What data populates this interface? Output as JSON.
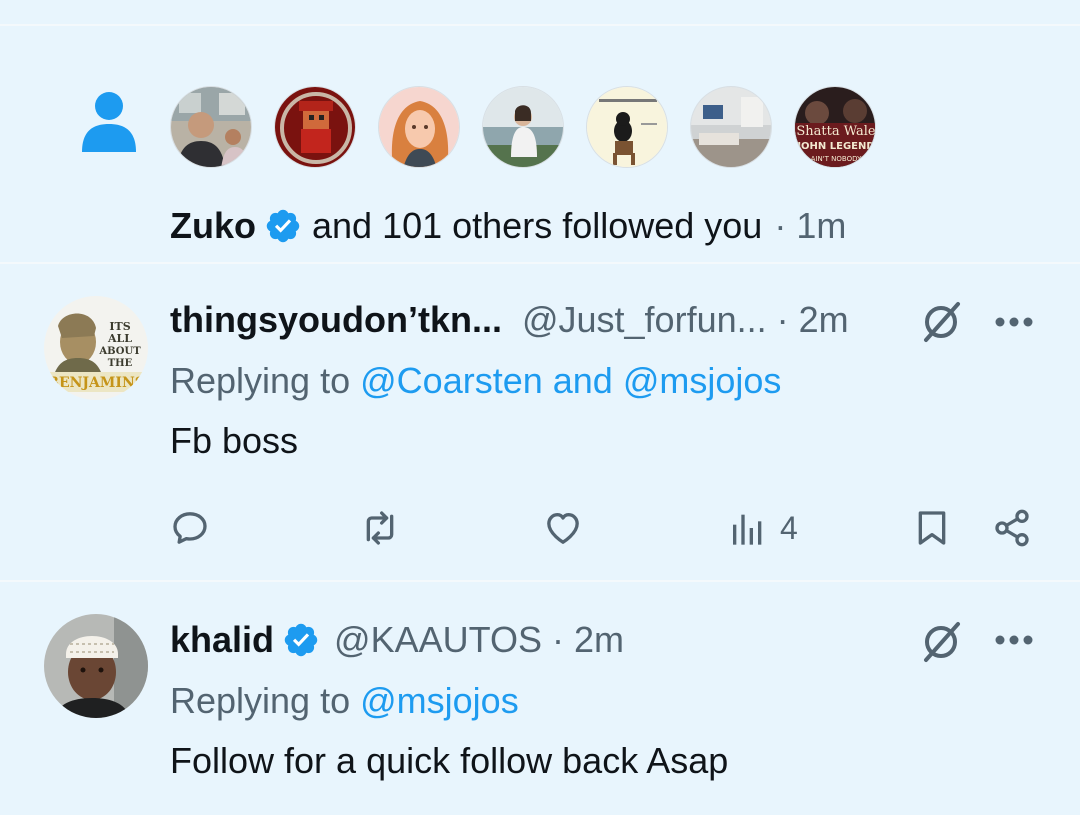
{
  "follow_notification": {
    "first_name": "Zuko",
    "rest_text": "and 101 others followed you",
    "separator": "·",
    "time": "1m",
    "avatars": [
      "avatar-man-office",
      "avatar-red-character",
      "avatar-redhead-illustration",
      "avatar-woman-lake",
      "avatar-dog-meme",
      "avatar-room-interior",
      "avatar-shatta-wale-john-legend"
    ],
    "avatar_text": {
      "shatta": "Shatta Wale",
      "legend": "JOHN LEGEND",
      "nobody": "AIN'T NOBODY"
    }
  },
  "tweets": [
    {
      "display_name": "thingsyoudon’tkn...",
      "handle": "@Just_forfun...",
      "separator": "·",
      "time": "2m",
      "replying_prefix": "Replying to",
      "replying_to": "@Coarsten and @msjojos",
      "body": "Fb boss",
      "avatar_text": "ITS ALL ABOUT THE BENJAMINS",
      "actions": {
        "views_count": "4"
      }
    },
    {
      "display_name": "khalid",
      "handle": "@KAAUTOS",
      "separator": "·",
      "time": "2m",
      "replying_prefix": "Replying to",
      "replying_to": "@msjojos",
      "body": "Follow for a quick follow back Asap"
    }
  ],
  "colors": {
    "background": "#e8f5fd",
    "accent": "#1d9bf0",
    "text": "#0f1419",
    "muted": "#536471"
  }
}
